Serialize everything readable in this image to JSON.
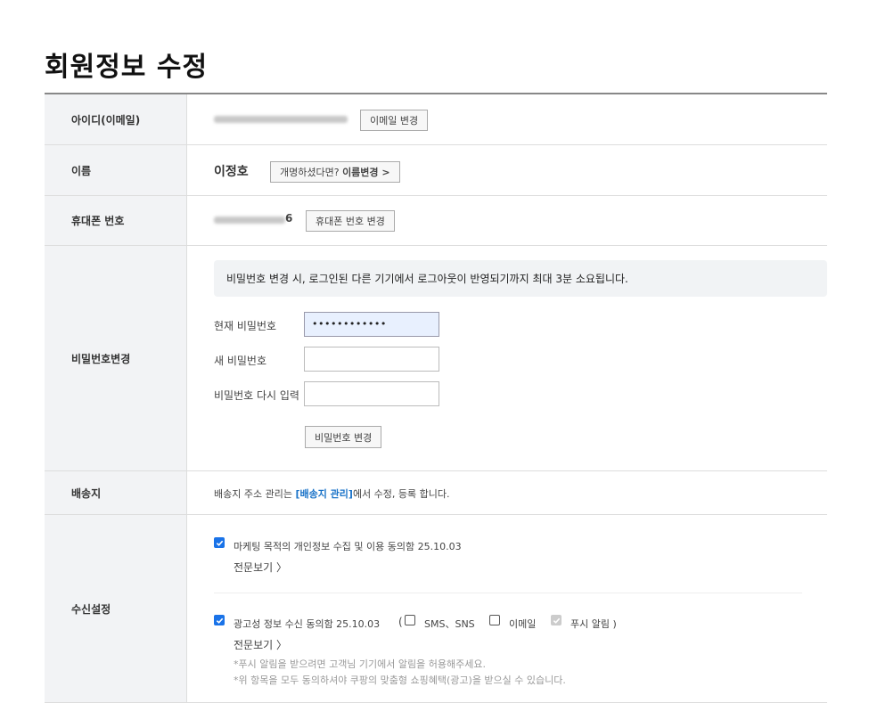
{
  "page_title": "회원정보 수정",
  "rows": {
    "id": {
      "label": "아이디(이메일)",
      "change_button": "이메일 변경"
    },
    "name": {
      "label": "이름",
      "value": "이정호",
      "change_prefix": "개명하셨다면?",
      "change_link": "이름변경 >"
    },
    "phone": {
      "label": "휴대폰 번호",
      "visible_suffix": "6",
      "change_button": "휴대폰 번호 변경"
    },
    "password": {
      "label": "비밀번호변경",
      "notice": "비밀번호 변경 시, 로그인된 다른 기기에서 로그아웃이 반영되기까지 최대 3분 소요됩니다.",
      "current_label": "현재 비밀번호",
      "current_value": "••••••••••••",
      "new_label": "새 비밀번호",
      "confirm_label": "비밀번호 다시 입력",
      "submit_button": "비밀번호 변경"
    },
    "shipping": {
      "label": "배송지",
      "text_before": "배송지 주소 관리는 ",
      "link": "[배송지 관리]",
      "text_after": "에서 수정, 등록 합니다."
    },
    "notifications": {
      "label": "수신설정",
      "marketing_consent": "마케팅 목적의 개인정보 수집 및 이용 동의함 25.10.03",
      "view_full_1": "전문보기 〉",
      "ad_consent": "광고성 정보 수신 동의함 25.10.03",
      "open_paren": "(",
      "sms_label": "SMS、SNS",
      "email_label": "이메일",
      "push_label": "푸시 알림 )",
      "view_full_2": "전문보기 〉",
      "note_1": "*푸시 알림을 받으려면 고객님 기기에서 알림을 허용해주세요.",
      "note_2": "*위 항목을 모두 동의하셔야 쿠팡의 맞춤형 쇼핑혜택(광고)을 받으실 수 있습니다."
    }
  },
  "colors": {
    "label_bg": "#f2f3f5",
    "checkbox_on": "#1a73e8",
    "link_blue": "#1a73c8"
  }
}
